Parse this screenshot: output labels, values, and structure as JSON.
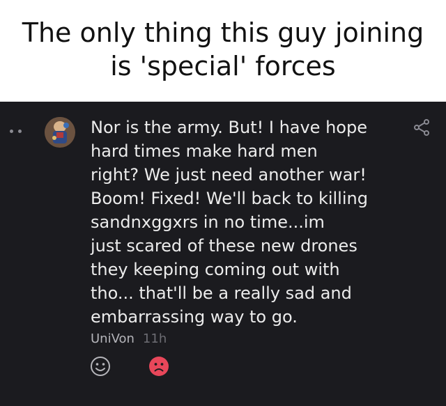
{
  "caption": {
    "line1": "The only thing this guy joining",
    "line2": "is 'special' forces"
  },
  "comment": {
    "lines": [
      "Nor is the army. But! I have hope",
      "hard times make hard men",
      "right? We just need another war!",
      "Boom! Fixed! We'll back to killing",
      "sandnxggxrs in no time...im",
      "just scared of these new drones",
      "they keeping coming out with",
      "tho... that'll be a really sad and",
      "embarrassing way to go."
    ],
    "author": "UniVon",
    "time": "11h"
  },
  "icons": {
    "menu": "more-dots-icon",
    "share": "share-icon",
    "smile_reaction": "smile-face-icon",
    "sad_reaction": "sad-face-icon"
  },
  "colors": {
    "card_background": "#1b1b1f",
    "text": "#ececec",
    "sad_reaction": "#e8475a",
    "author": "#b5b5ba",
    "time": "#6d6d73"
  }
}
